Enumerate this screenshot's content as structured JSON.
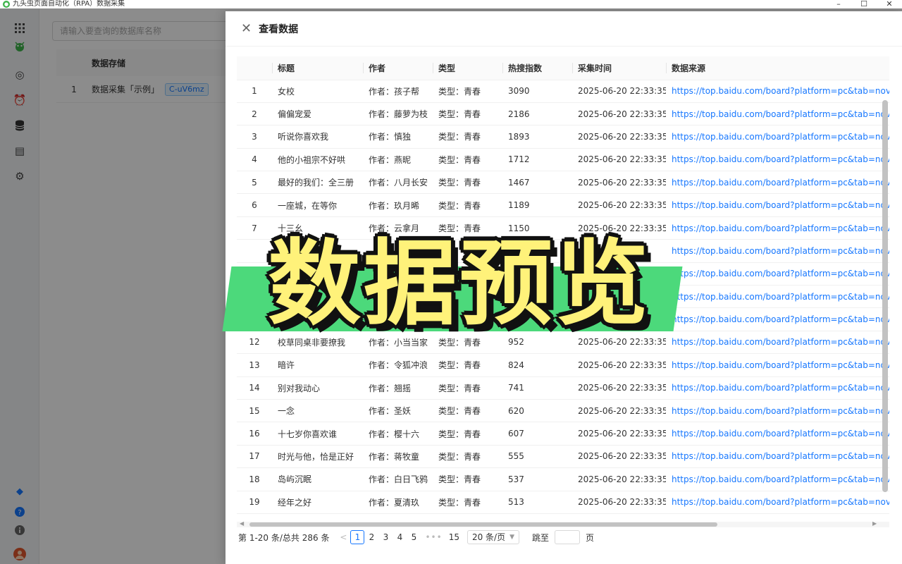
{
  "window": {
    "title": "九头虫页面自动化（RPA）数据采集",
    "controls": [
      "–",
      "☐",
      "✕"
    ]
  },
  "sidebar": {
    "icons": [
      "apps-grid-icon",
      "bug-logo-icon",
      "target-icon",
      "alarm-icon",
      "database-icon",
      "document-icon",
      "settings-icon",
      "diamond-icon",
      "help-icon",
      "info-icon",
      "avatar"
    ]
  },
  "background": {
    "search_placeholder": "请输入要查询的数据库名称",
    "table_header": "数据存储",
    "rows": [
      {
        "index": "1",
        "name": "数据采集「示例」",
        "tag": "C-uV6mz"
      }
    ]
  },
  "drawer": {
    "title": "查看数据",
    "columns": [
      "",
      "标题",
      "作者",
      "类型",
      "热搜指数",
      "采集时间",
      "数据来源"
    ],
    "rows": [
      {
        "index": "1",
        "title": "女校",
        "author": "作者：孩子帮",
        "type": "类型：青春",
        "hot": "3090",
        "time": "2025-06-20 22:33:35",
        "source": "https://top.baidu.com/board?platform=pc&tab=novel&ta"
      },
      {
        "index": "2",
        "title": "偏偏宠爱",
        "author": "作者：藤萝为枝",
        "type": "类型：青春",
        "hot": "2186",
        "time": "2025-06-20 22:33:35",
        "source": "https://top.baidu.com/board?platform=pc&tab=novel&ta"
      },
      {
        "index": "3",
        "title": "听说你喜欢我",
        "author": "作者：慎独",
        "type": "类型：青春",
        "hot": "1893",
        "time": "2025-06-20 22:33:35",
        "source": "https://top.baidu.com/board?platform=pc&tab=novel&ta"
      },
      {
        "index": "4",
        "title": "他的小祖宗不好哄",
        "author": "作者：燕昵",
        "type": "类型：青春",
        "hot": "1712",
        "time": "2025-06-20 22:33:35",
        "source": "https://top.baidu.com/board?platform=pc&tab=novel&ta"
      },
      {
        "index": "5",
        "title": "最好的我们：全三册",
        "author": "作者：八月长安",
        "type": "类型：青春",
        "hot": "1467",
        "time": "2025-06-20 22:33:35",
        "source": "https://top.baidu.com/board?platform=pc&tab=novel&ta"
      },
      {
        "index": "6",
        "title": "一座城，在等你",
        "author": "作者：玖月晞",
        "type": "类型：青春",
        "hot": "1189",
        "time": "2025-06-20 22:33:35",
        "source": "https://top.baidu.com/board?platform=pc&tab=novel&ta"
      },
      {
        "index": "7",
        "title": "十三幺",
        "author": "作者：云拿月",
        "type": "类型：青春",
        "hot": "1150",
        "time": "2025-06-20 22:33:35",
        "source": "https://top.baidu.com/board?platform=pc&tab=novel&ta"
      },
      {
        "index": "",
        "title": "",
        "author": "",
        "type": "",
        "hot": "",
        "time": "",
        "source": "https://top.baidu.com/board?platform=pc&tab=novel&ta"
      },
      {
        "index": "",
        "title": "",
        "author": "",
        "type": "",
        "hot": "",
        "time": "",
        "source": "https://top.baidu.com/board?platform=pc&tab=novel&ta"
      },
      {
        "index": "",
        "title": "",
        "author": "",
        "type": "",
        "hot": "",
        "time": "",
        "source": "https://top.baidu.com/board?platform=pc&tab=novel&ta"
      },
      {
        "index": "",
        "title": "",
        "author": "",
        "type": "",
        "hot": "",
        "time": "",
        "source": "https://top.baidu.com/board?platform=pc&tab=novel&ta"
      },
      {
        "index": "12",
        "title": "校草同桌非要撩我",
        "author": "作者：小当当家",
        "type": "类型：青春",
        "hot": "952",
        "time": "2025-06-20 22:33:35",
        "source": "https://top.baidu.com/board?platform=pc&tab=novel&ta"
      },
      {
        "index": "13",
        "title": "暗许",
        "author": "作者：令狐冲浪",
        "type": "类型：青春",
        "hot": "824",
        "time": "2025-06-20 22:33:35",
        "source": "https://top.baidu.com/board?platform=pc&tab=novel&ta"
      },
      {
        "index": "14",
        "title": "别对我动心",
        "author": "作者：翘摇",
        "type": "类型：青春",
        "hot": "741",
        "time": "2025-06-20 22:33:35",
        "source": "https://top.baidu.com/board?platform=pc&tab=novel&ta"
      },
      {
        "index": "15",
        "title": "一念",
        "author": "作者：圣妖",
        "type": "类型：青春",
        "hot": "620",
        "time": "2025-06-20 22:33:35",
        "source": "https://top.baidu.com/board?platform=pc&tab=novel&ta"
      },
      {
        "index": "16",
        "title": "十七岁你喜欢谁",
        "author": "作者：樱十六",
        "type": "类型：青春",
        "hot": "607",
        "time": "2025-06-20 22:33:35",
        "source": "https://top.baidu.com/board?platform=pc&tab=novel&ta"
      },
      {
        "index": "17",
        "title": "时光与他，恰是正好",
        "author": "作者：蒋牧童",
        "type": "类型：青春",
        "hot": "555",
        "time": "2025-06-20 22:33:35",
        "source": "https://top.baidu.com/board?platform=pc&tab=novel&ta"
      },
      {
        "index": "18",
        "title": "岛屿沉眠",
        "author": "作者：白日飞鸦",
        "type": "类型：青春",
        "hot": "537",
        "time": "2025-06-20 22:33:35",
        "source": "https://top.baidu.com/board?platform=pc&tab=novel&ta"
      },
      {
        "index": "19",
        "title": "经年之好",
        "author": "作者：夏清玖",
        "type": "类型：青春",
        "hot": "513",
        "time": "2025-06-20 22:33:35",
        "source": "https://top.baidu.com/board?platform=pc&tab=novel&ta"
      }
    ]
  },
  "pagination": {
    "total": "第 1-20 条/总共 286 条",
    "prev": "<",
    "pages": [
      "1",
      "2",
      "3",
      "4",
      "5"
    ],
    "ellipsis": "•••",
    "last": "15",
    "page_size": "20 条/页",
    "jump_label": "跳至",
    "page_label": "页"
  },
  "caption": "数据预览"
}
